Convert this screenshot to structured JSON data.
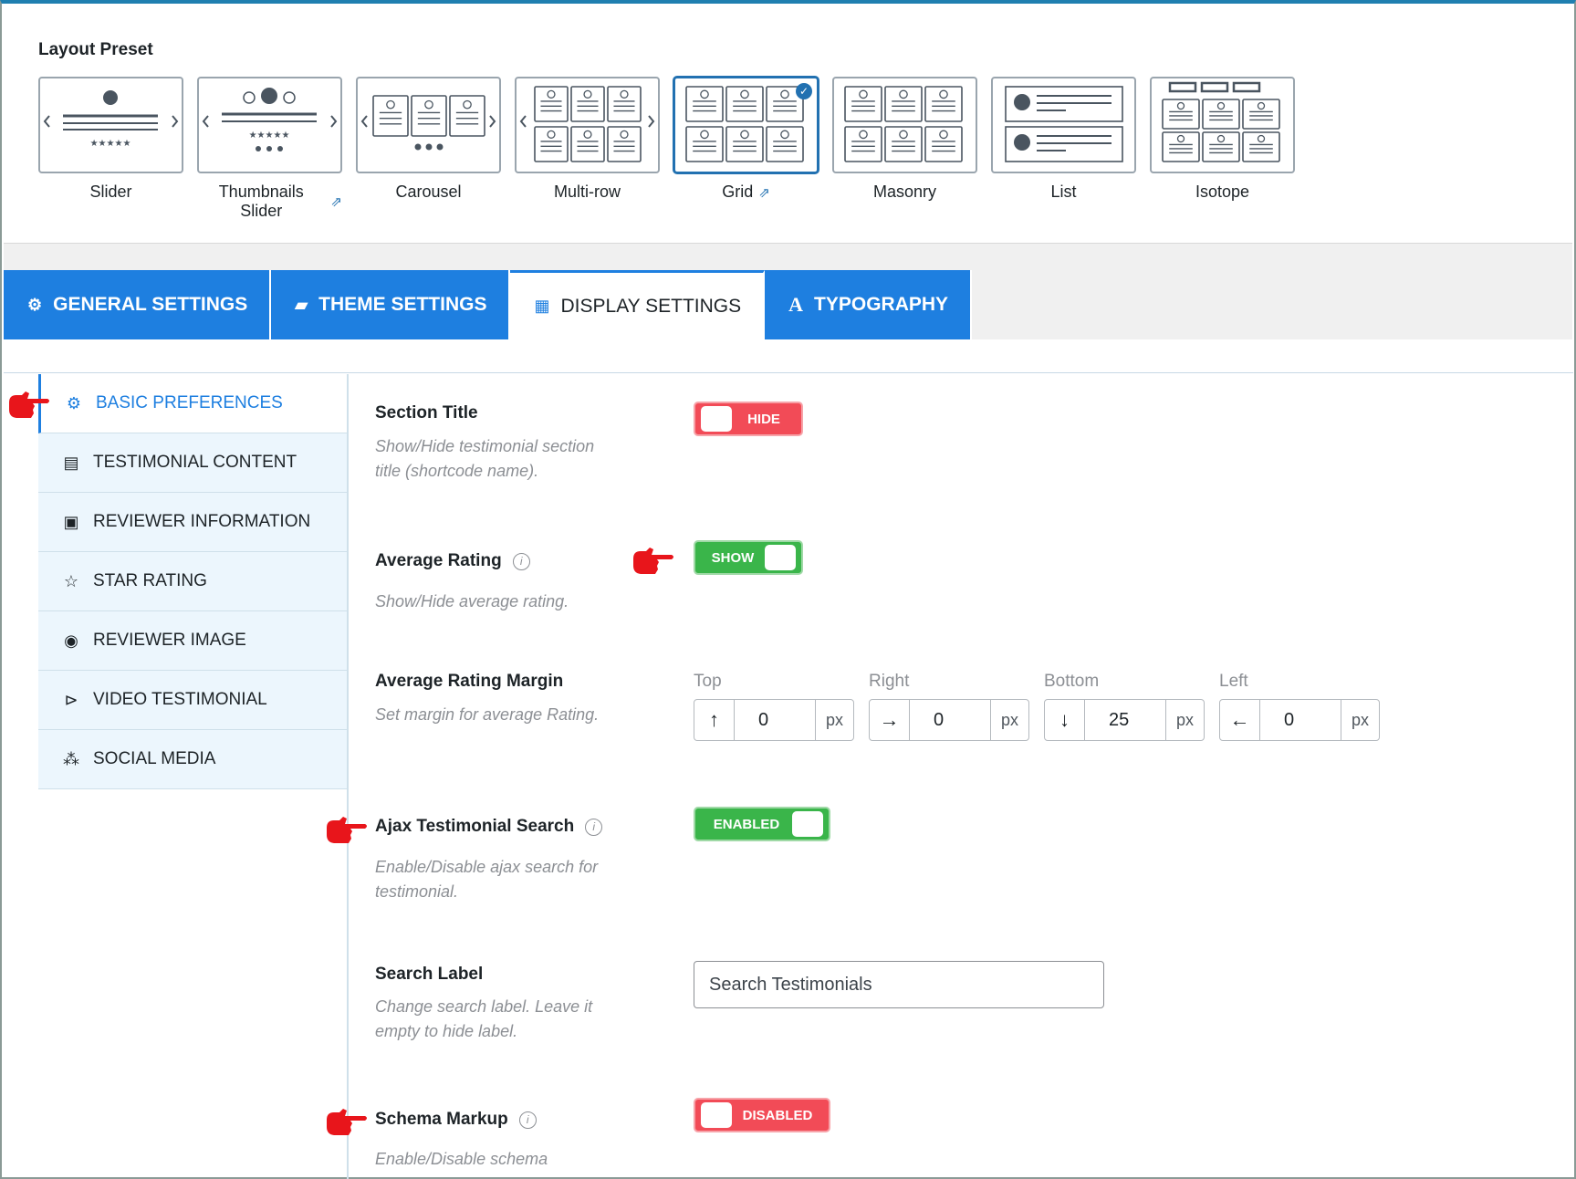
{
  "preset_section": {
    "title": "Layout Preset",
    "presets": [
      {
        "label": "Slider",
        "external": false,
        "selected": false,
        "kind": "slider"
      },
      {
        "label": "Thumbnails Slider",
        "external": true,
        "selected": false,
        "kind": "thumbs"
      },
      {
        "label": "Carousel",
        "external": false,
        "selected": false,
        "kind": "carousel"
      },
      {
        "label": "Multi-row",
        "external": false,
        "selected": false,
        "kind": "multirow"
      },
      {
        "label": "Grid",
        "external": true,
        "selected": true,
        "kind": "grid"
      },
      {
        "label": "Masonry",
        "external": false,
        "selected": false,
        "kind": "masonry"
      },
      {
        "label": "List",
        "external": false,
        "selected": false,
        "kind": "list"
      },
      {
        "label": "Isotope",
        "external": false,
        "selected": false,
        "kind": "isotope"
      }
    ]
  },
  "tabs": [
    {
      "label": "GENERAL SETTINGS",
      "icon": "gear-icon",
      "active": false
    },
    {
      "label": "THEME SETTINGS",
      "icon": "theme-icon",
      "active": false
    },
    {
      "label": "DISPLAY SETTINGS",
      "icon": "grid-icon",
      "active": true
    },
    {
      "label": "TYPOGRAPHY",
      "icon": "typography-icon",
      "active": false
    }
  ],
  "sidebar": {
    "items": [
      {
        "label": "BASIC PREFERENCES",
        "icon": "gear-icon",
        "active": true
      },
      {
        "label": "TESTIMONIAL CONTENT",
        "icon": "comment-icon",
        "active": false
      },
      {
        "label": "REVIEWER INFORMATION",
        "icon": "id-card-icon",
        "active": false
      },
      {
        "label": "STAR RATING",
        "icon": "star-icon",
        "active": false
      },
      {
        "label": "REVIEWER IMAGE",
        "icon": "user-circle-icon",
        "active": false
      },
      {
        "label": "VIDEO TESTIMONIAL",
        "icon": "video-icon",
        "active": false
      },
      {
        "label": "SOCIAL MEDIA",
        "icon": "share-icon",
        "active": false
      }
    ]
  },
  "fields": {
    "section_title": {
      "label": "Section Title",
      "desc": "Show/Hide testimonial section title (shortcode name).",
      "toggle": "HIDE"
    },
    "average_rating": {
      "label": "Average Rating",
      "desc": "Show/Hide average rating.",
      "toggle": "SHOW"
    },
    "average_rating_margin": {
      "label": "Average Rating Margin",
      "desc": "Set margin for average Rating.",
      "sides": [
        {
          "label": "Top",
          "arrow": "↑",
          "value": "0",
          "unit": "px"
        },
        {
          "label": "Right",
          "arrow": "→",
          "value": "0",
          "unit": "px"
        },
        {
          "label": "Bottom",
          "arrow": "↓",
          "value": "25",
          "unit": "px"
        },
        {
          "label": "Left",
          "arrow": "←",
          "value": "0",
          "unit": "px"
        }
      ]
    },
    "ajax_search": {
      "label": "Ajax Testimonial Search",
      "desc": "Enable/Disable ajax search for testimonial.",
      "toggle": "ENABLED"
    },
    "search_label": {
      "label": "Search Label",
      "desc": "Change search label. Leave it empty to hide label.",
      "value": "Search Testimonials"
    },
    "schema_markup": {
      "label": "Schema Markup",
      "desc": "Enable/Disable schema",
      "toggle": "DISABLED"
    }
  },
  "colors": {
    "accent": "#1e7fe0",
    "toggle_on": "#3ab54a",
    "toggle_off": "#f24b57",
    "pointer": "#e8151b"
  }
}
